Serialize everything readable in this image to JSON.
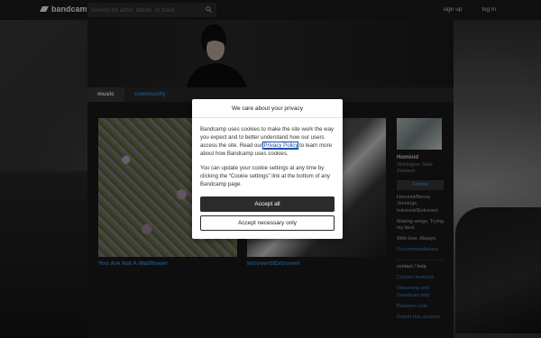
{
  "topbar": {
    "logo": "bandcamp",
    "search_placeholder": "Search for artist, album, or track",
    "signup": "sign up",
    "login": "log in"
  },
  "tabs": [
    "music",
    "community"
  ],
  "albums": [
    {
      "title": "You Are Not A Wallflower"
    },
    {
      "title": "Introvert//Extrovert"
    }
  ],
  "artist": {
    "name": "Hominid",
    "location": "Wellington, New Zealand",
    "follow_label": "Follow",
    "bio1": "Hominid/Benny Jennings Introvert//Extrovert.",
    "bio2": "Making songs. Trying my best.",
    "bio3": "With love. Always.",
    "recommendations": "Recommendations",
    "contact": "contact / help",
    "links": [
      "Contact Hominid",
      "Streaming and Download help",
      "Redeem code",
      "Report this account"
    ]
  },
  "modal": {
    "title": "We care about your privacy",
    "text1_pre": "Bandcamp uses cookies to make the site work the way you expect and to better understand how our users access the site. Read our ",
    "privacy_link": "Privacy Policy",
    "text1_post": " to learn more about how Bandcamp uses cookies.",
    "text2": "You can update your cookie settings at any time by clicking the “Cookie settings” link at the bottom of any Bandcamp page.",
    "accept_all": "Accept all",
    "accept_necessary": "Accept necessary only"
  }
}
